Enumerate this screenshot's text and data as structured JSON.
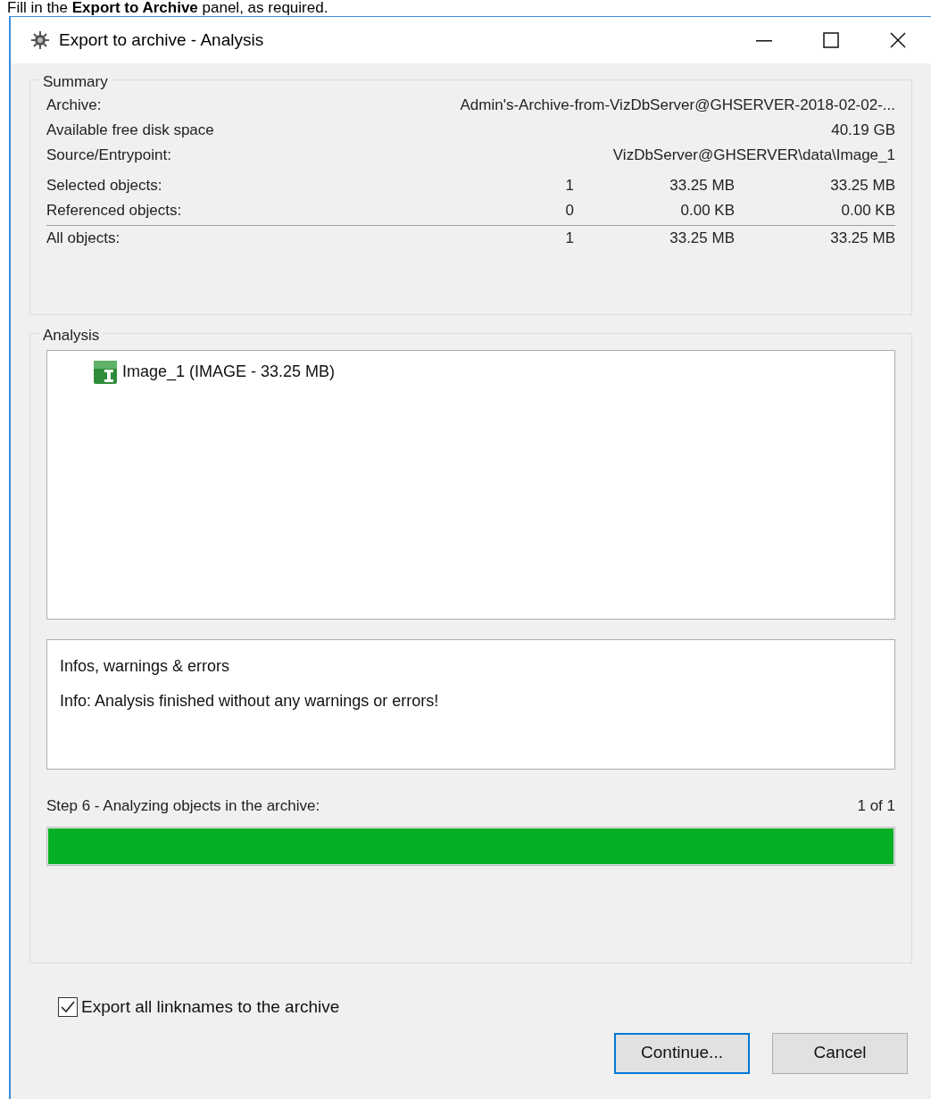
{
  "instruction": "Fill in the **Export to Archive** panel, as required.",
  "window": {
    "title": "Export to archive - Analysis"
  },
  "summary": {
    "title": "Summary",
    "info_rows": [
      {
        "label": "Archive:",
        "value": "Admin's-Archive-from-VizDbServer@GHSERVER-2018-02-02-..."
      },
      {
        "label": "Available free disk space",
        "value": "40.19 GB"
      },
      {
        "label": "Source/Entrypoint:",
        "value": "VizDbServer@GHSERVER\\data\\Image_1"
      }
    ],
    "count_rows": [
      {
        "label": "Selected objects:",
        "count": "1",
        "size": "33.25 MB",
        "total": "33.25 MB",
        "kind": "row"
      },
      {
        "label": "Referenced objects:",
        "count": "0",
        "size": "0.00 KB",
        "total": "0.00 KB",
        "kind": "row"
      },
      {
        "label": "All objects:",
        "count": "1",
        "size": "33.25 MB",
        "total": "33.25 MB",
        "kind": "total"
      }
    ]
  },
  "analysis": {
    "title": "Analysis",
    "tree": [
      {
        "label": "Image_1 (IMAGE - 33.25 MB)"
      }
    ],
    "messages": [
      "Infos, warnings & errors",
      "Info: Analysis finished without any warnings or errors!"
    ],
    "step": {
      "label": "Step 6 - Analyzing objects in the archive:",
      "count": "1 of 1",
      "level": 1
    }
  },
  "export_linknames": {
    "label": "Export all linknames to the archive",
    "checked": true
  },
  "buttons": [
    {
      "label": "Continue...",
      "default": true
    },
    {
      "label": "Cancel",
      "default": false
    }
  ]
}
